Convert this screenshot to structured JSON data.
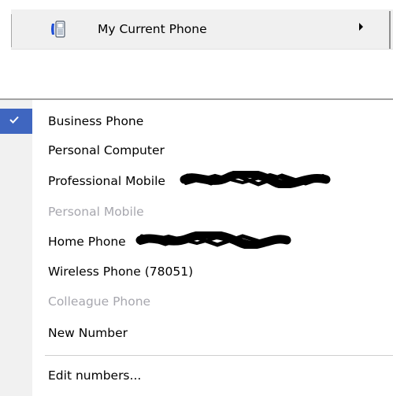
{
  "top_bar": {
    "label": "My Current Phone",
    "icon": "phone-icon",
    "arrow_icon": "submenu-arrow-icon"
  },
  "menu": {
    "items": [
      {
        "label": "Business Phone",
        "checked": true,
        "enabled": true
      },
      {
        "label": "Personal Computer",
        "checked": false,
        "enabled": true
      },
      {
        "label": "Professional Mobile",
        "checked": false,
        "enabled": true,
        "redacted": true
      },
      {
        "label": "Personal Mobile",
        "checked": false,
        "enabled": false
      },
      {
        "label": "Home Phone",
        "checked": false,
        "enabled": true,
        "redacted": true
      },
      {
        "label": "Wireless Phone (78051)",
        "checked": false,
        "enabled": true
      },
      {
        "label": "Colleague Phone",
        "checked": false,
        "enabled": false
      },
      {
        "label": "New Number",
        "checked": false,
        "enabled": true
      }
    ],
    "footer_item": {
      "label": "Edit numbers..."
    }
  },
  "colors": {
    "check_highlight": "#3f66c0",
    "disabled_text": "#a7a7ae",
    "gutter": "#f1f1f1",
    "top_bar_bg": "#f0f0f0"
  }
}
